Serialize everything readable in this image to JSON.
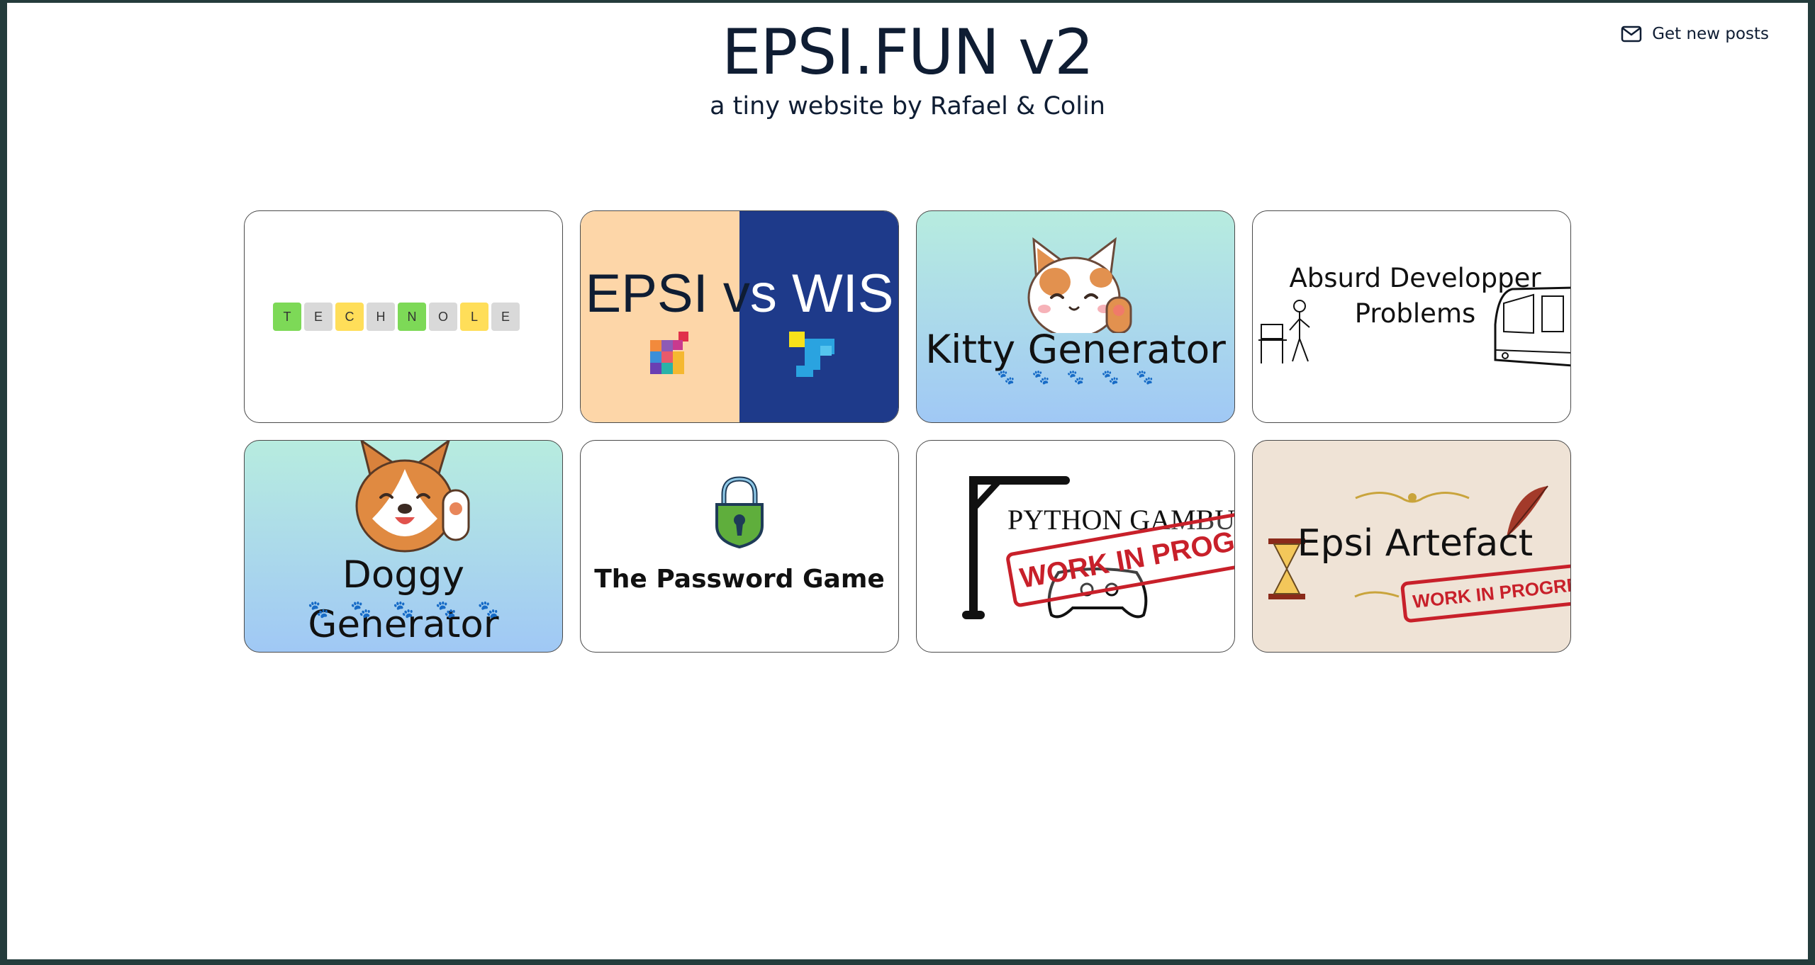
{
  "header": {
    "title": "EPSI.FUN v2",
    "subtitle": "a tiny website by Rafael & Colin",
    "get_posts_label": "Get new posts"
  },
  "cards": {
    "technole": {
      "tiles": [
        {
          "letter": "T",
          "color": "#7dd957"
        },
        {
          "letter": "E",
          "color": "#d9d9d9"
        },
        {
          "letter": "C",
          "color": "#ffde59"
        },
        {
          "letter": "H",
          "color": "#d9d9d9"
        },
        {
          "letter": "N",
          "color": "#7dd957"
        },
        {
          "letter": "O",
          "color": "#d9d9d9"
        },
        {
          "letter": "L",
          "color": "#ffde59"
        },
        {
          "letter": "E",
          "color": "#d9d9d9"
        }
      ]
    },
    "epsi_vs_wis": {
      "left": "EPSI v",
      "right": "s WIS"
    },
    "kitty": {
      "label": "Kitty Generator"
    },
    "absurd": {
      "line1": "Absurd Developper",
      "line2": "Problems"
    },
    "doggy": {
      "label": "Doggy Generator"
    },
    "password": {
      "label": "The Password Game"
    },
    "python": {
      "label": "PYTHON GAMBU",
      "stamp": "WORK IN PROGRESS"
    },
    "artefact": {
      "label": "Epsi Artefact",
      "stamp": "WORK IN PROGRESS"
    }
  },
  "colors": {
    "page_border": "#243c3c",
    "text": "#0f1d33",
    "paw": "#e56a4c",
    "stamp": "#c8202a"
  },
  "icons": {
    "get_posts": "mail-icon"
  }
}
